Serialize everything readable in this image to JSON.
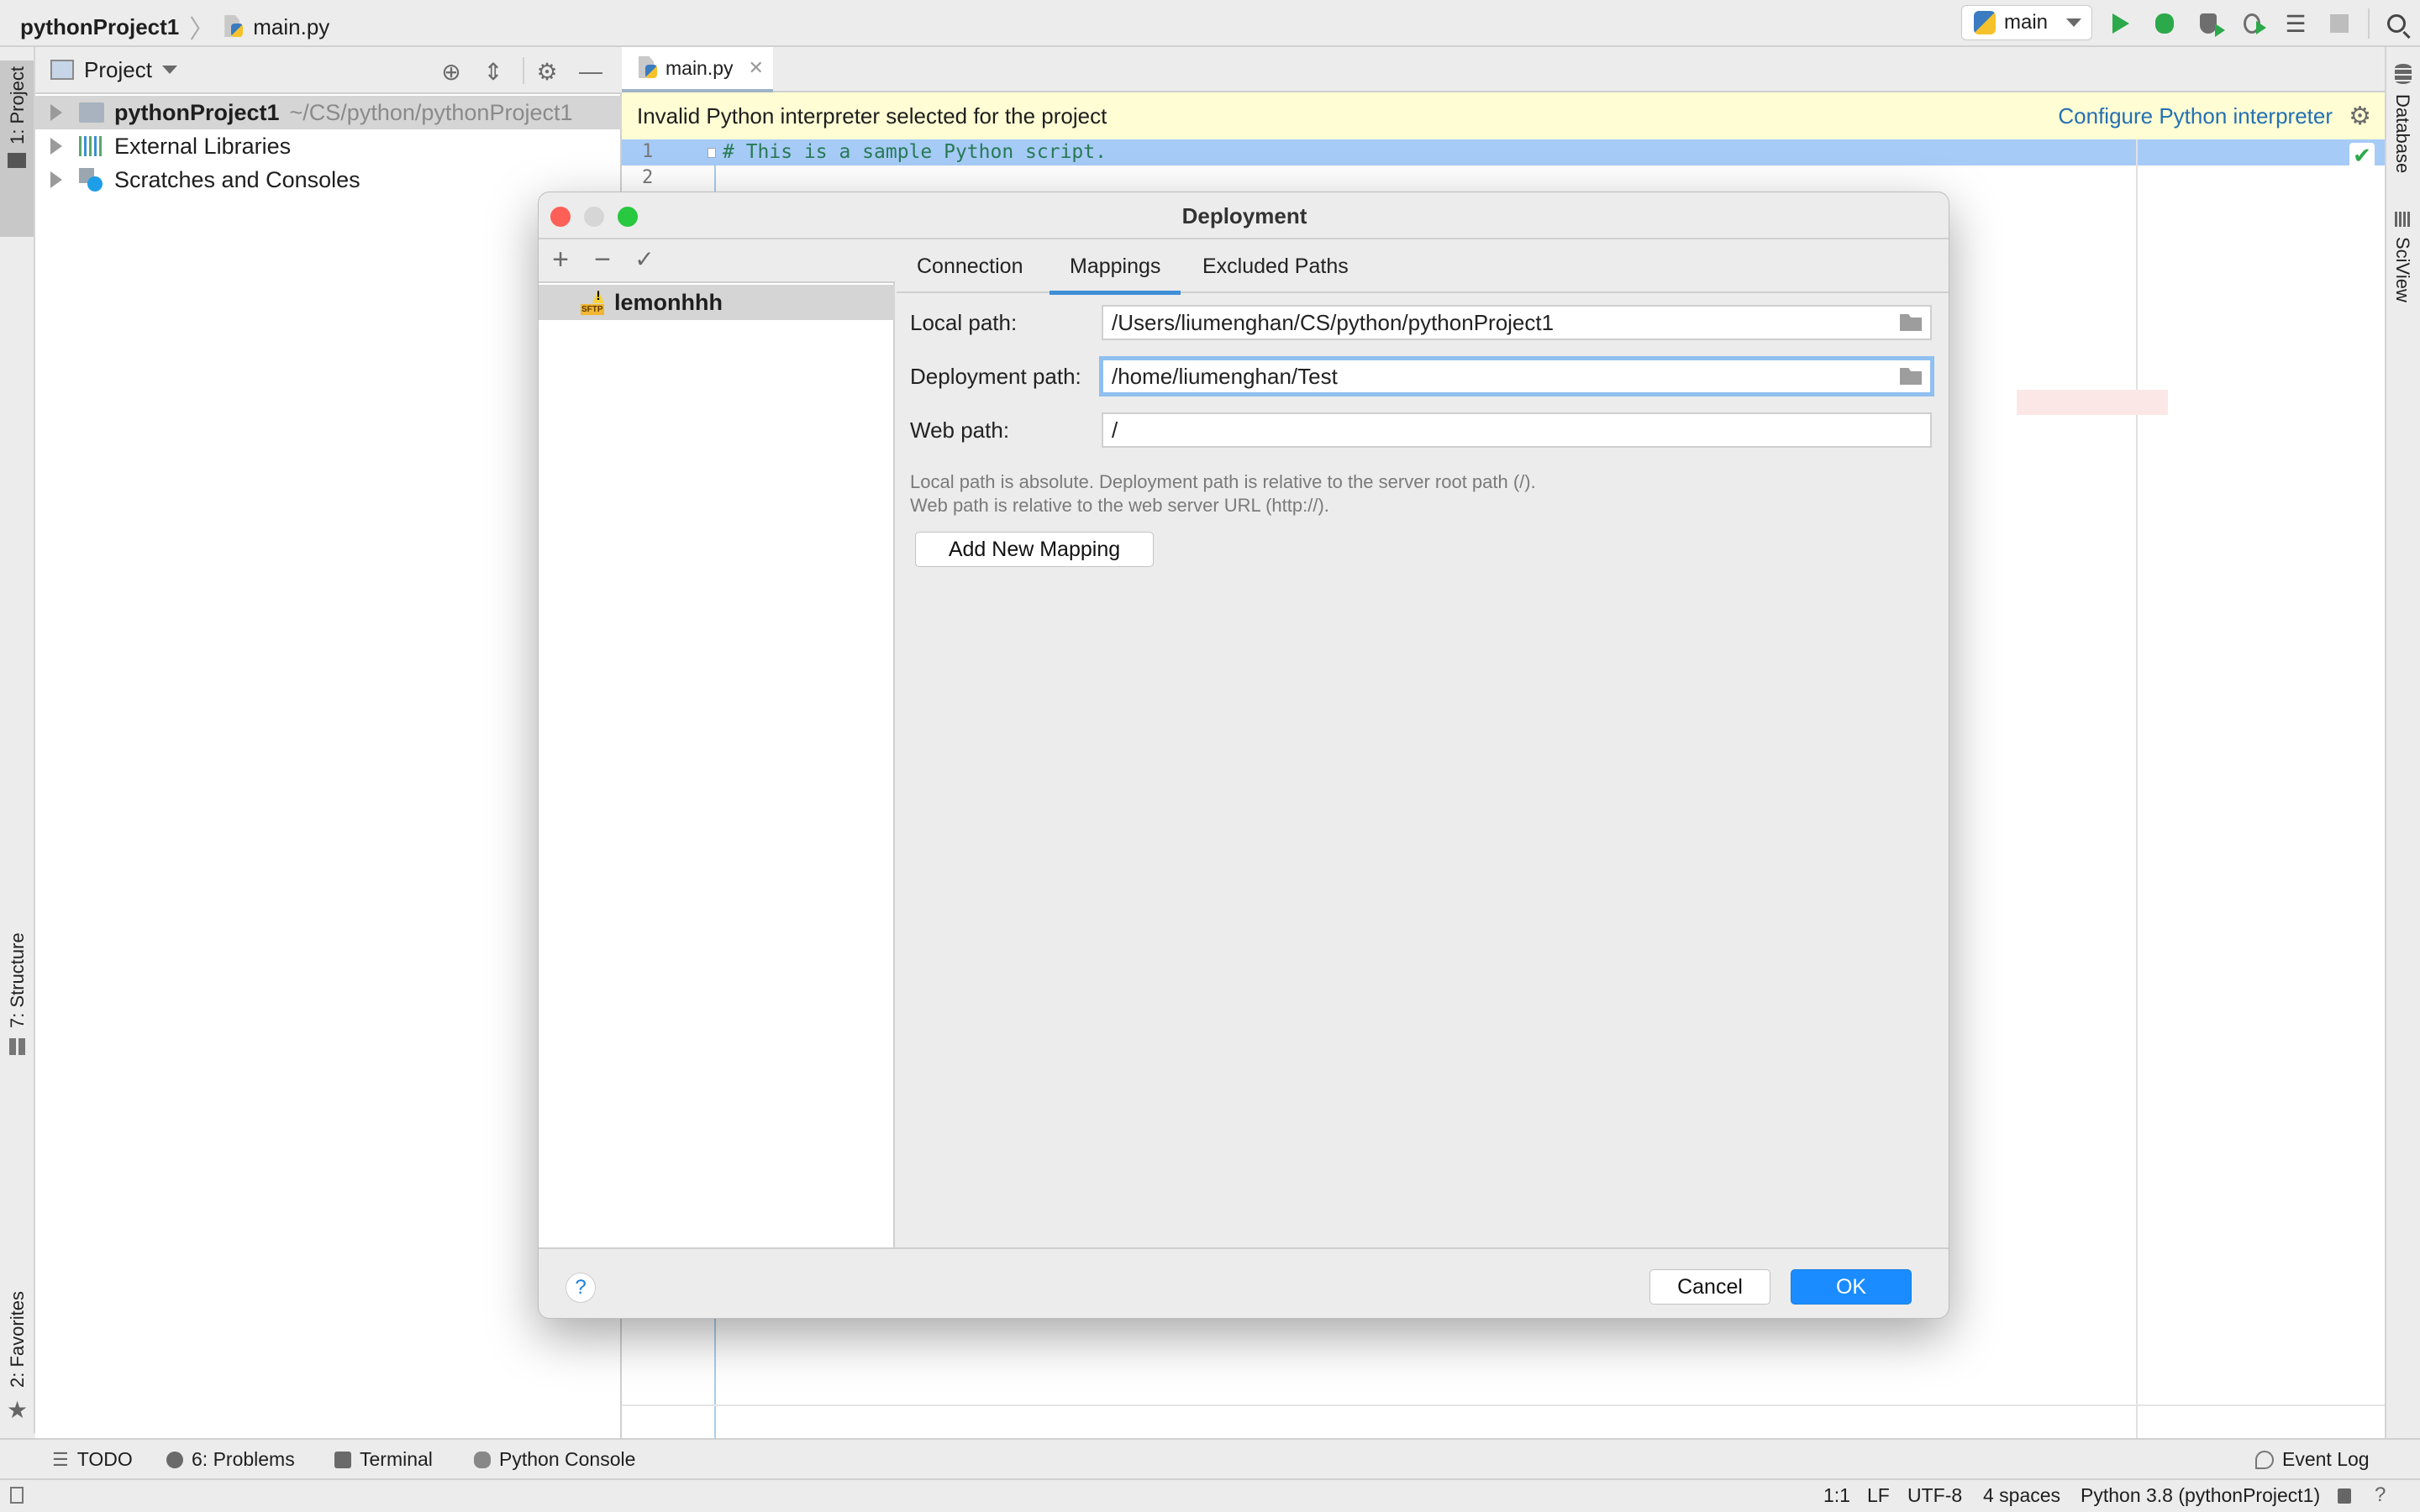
{
  "navbar": {
    "project": "pythonProject1",
    "file": "main.py",
    "run_config": "main",
    "icons": [
      "python-icon",
      "run-icon",
      "debug-icon",
      "coverage-icon",
      "profile-icon",
      "run-concurrency-icon",
      "stop-icon",
      "search-icon"
    ]
  },
  "left_strip": {
    "items": [
      {
        "label": "1: Project",
        "icon": "folder-icon"
      },
      {
        "label": "7: Structure",
        "icon": "structure-icon"
      },
      {
        "label": "2: Favorites",
        "icon": "star-icon"
      }
    ]
  },
  "right_strip": {
    "items": [
      {
        "label": "Database",
        "icon": "database-icon"
      },
      {
        "label": "SciView",
        "icon": "grid-icon"
      }
    ]
  },
  "project_panel": {
    "title": "Project",
    "tree": [
      {
        "label": "pythonProject1",
        "path": "~/CS/python/pythonProject1",
        "selected": true
      },
      {
        "label": "External Libraries"
      },
      {
        "label": "Scratches and Consoles"
      }
    ]
  },
  "editor": {
    "tab": "main.py",
    "banner_text": "Invalid Python interpreter selected for the project",
    "banner_link": "Configure Python interpreter",
    "lines": [
      {
        "num": "1",
        "text": "# This is a sample Python script."
      },
      {
        "num": "2",
        "text": ""
      }
    ]
  },
  "dialog": {
    "title": "Deployment",
    "toolbar": {
      "add": "+",
      "remove": "−",
      "default": "✓"
    },
    "servers": [
      {
        "name": "lemonhhh",
        "type": "SFTP"
      }
    ],
    "tabs": [
      {
        "label": "Connection",
        "active": false
      },
      {
        "label": "Mappings",
        "active": true
      },
      {
        "label": "Excluded Paths",
        "active": false
      }
    ],
    "fields": {
      "local_label": "Local path:",
      "local_value": "/Users/liumenghan/CS/python/pythonProject1",
      "deploy_label": "Deployment path:",
      "deploy_value": "/home/liumenghan/Test",
      "web_label": "Web path:",
      "web_value": "/"
    },
    "hint1": "Local path is absolute. Deployment path is relative to the server root path (/).",
    "hint2": "Web path is relative to the web server URL (http://).",
    "add_mapping": "Add New Mapping",
    "help": "?",
    "cancel": "Cancel",
    "ok": "OK"
  },
  "bottom_bar": {
    "items": [
      "TODO",
      "6: Problems",
      "Terminal",
      "Python Console"
    ],
    "event_log": "Event Log"
  },
  "status_bar": {
    "position": "1:1",
    "line_sep": "LF",
    "encoding": "UTF-8",
    "indent": "4 spaces",
    "interpreter": "Python 3.8 (pythonProject1)"
  }
}
